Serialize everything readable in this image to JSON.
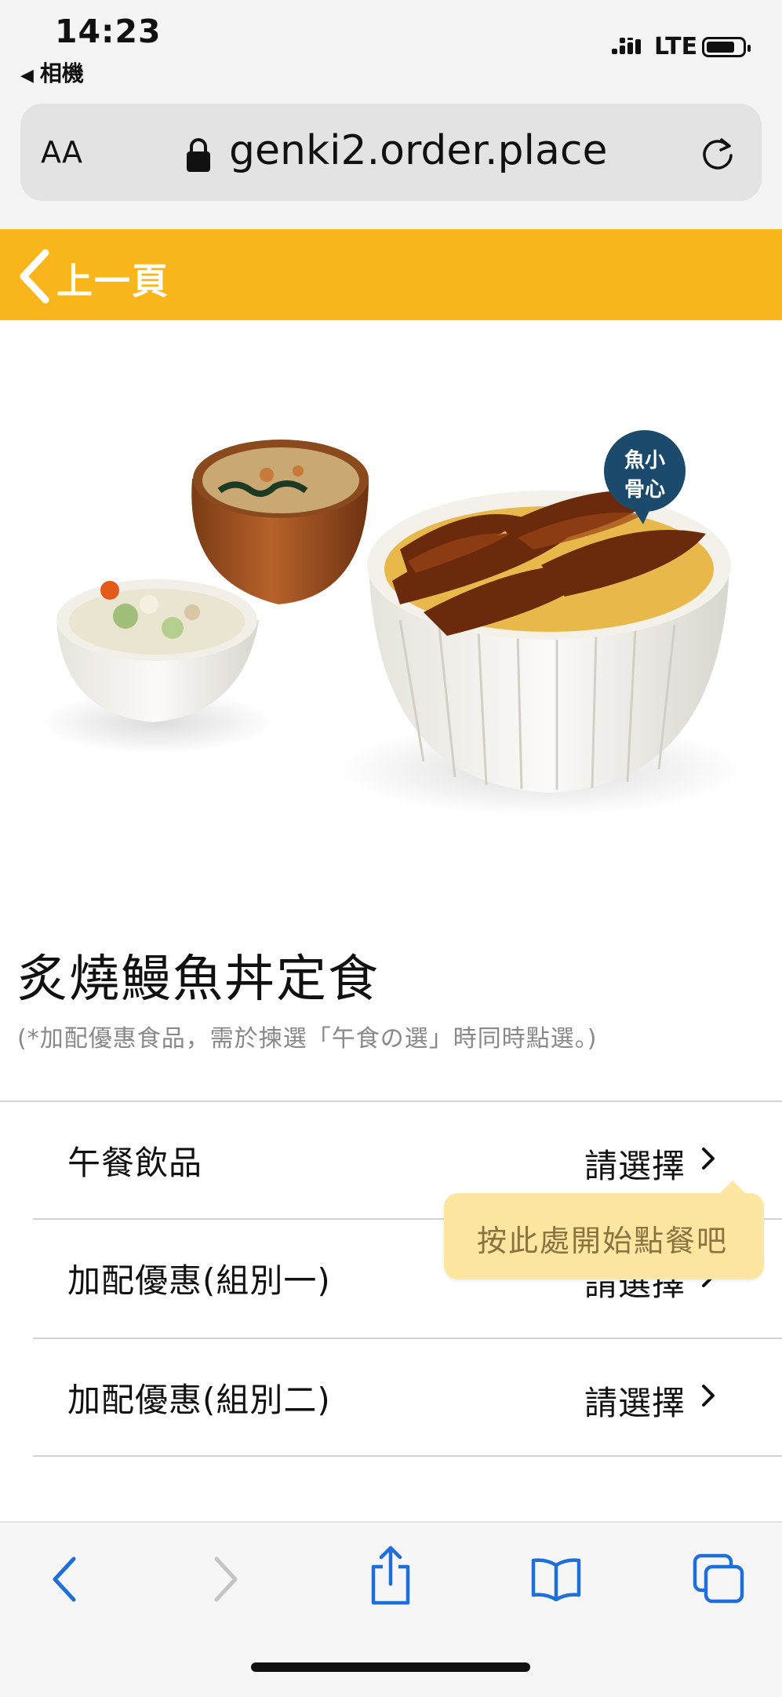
{
  "status_bar": {
    "time": "14:23",
    "back_app": "相機",
    "network": "LTE",
    "battery_level": 0.75
  },
  "browser": {
    "text_size_label": "AA",
    "url": "genki2.order.place"
  },
  "nav": {
    "back_label": "上一頁"
  },
  "product": {
    "badge_line1": "魚小",
    "badge_line2": "骨心",
    "title": "炙燒鰻魚丼定食",
    "note": "(*加配優惠食品，需於揀選「午食の選」時同時點選。)"
  },
  "options": [
    {
      "label": "午餐飲品",
      "value": "請選擇"
    },
    {
      "label": "加配優惠(組別一)",
      "value": "請選擇"
    },
    {
      "label": "加配優惠(組別二)",
      "value": "請選擇"
    }
  ],
  "tooltip": {
    "text": "按此處開始點餐吧"
  },
  "colors": {
    "nav_yellow": "#f9b61c",
    "tooltip_bg": "#fde7a0",
    "toolbar_blue": "#1e6fd9",
    "badge_navy": "#1b4a6c"
  },
  "toolbar_icons": [
    "back-icon",
    "forward-icon",
    "share-icon",
    "bookmarks-icon",
    "tabs-icon"
  ]
}
